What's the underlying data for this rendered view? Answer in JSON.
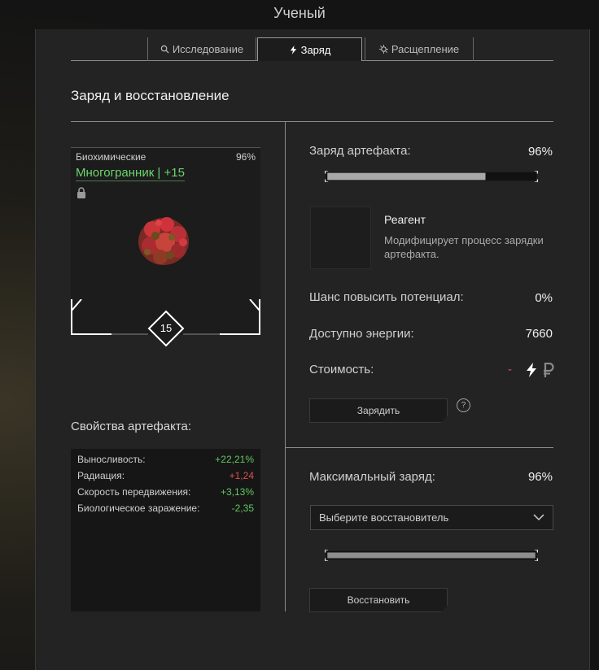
{
  "window": {
    "title": "Ученый"
  },
  "tabs": [
    {
      "label": "Исследование",
      "icon": "search-icon"
    },
    {
      "label": "Заряд",
      "icon": "lightning-icon",
      "active": true
    },
    {
      "label": "Расщепление",
      "icon": "split-icon"
    }
  ],
  "section_title": "Заряд и восстановление",
  "artifact": {
    "category": "Биохимические",
    "percent": "96%",
    "name": "Многогранник | +15",
    "level": "15",
    "locked": true
  },
  "properties": {
    "title": "Свойства артефакта:",
    "rows": [
      {
        "label": "Выносливость:",
        "value": "+22,21%",
        "color": "#5fc95f"
      },
      {
        "label": "Радиация:",
        "value": "+1,24",
        "color": "#e05050"
      },
      {
        "label": "Скорость передвижения:",
        "value": "+3,13%",
        "color": "#5fc95f"
      },
      {
        "label": "Биологическое заражение:",
        "value": "-2,35",
        "color": "#5fc95f"
      }
    ]
  },
  "charge": {
    "label": "Заряд артефакта:",
    "value": "96%",
    "fill": 0.76
  },
  "reagent": {
    "title": "Реагент",
    "description": "Модифицирует процесс зарядки артефакта."
  },
  "stats": {
    "chance_label": "Шанс повысить потенциал:",
    "chance_value": "0%",
    "energy_label": "Доступно энергии:",
    "energy_value": "7660",
    "cost_label": "Стоимость:",
    "cost_value": "-",
    "cost_icons": [
      "lightning-icon",
      "ruble-icon"
    ]
  },
  "charge_button": "Зарядить",
  "help": "?",
  "max_charge": {
    "label": "Максимальный заряд:",
    "value": "96%",
    "select_placeholder": "Выберите восстановитель",
    "fill": 1.0
  },
  "restore_button": "Восстановить",
  "colors": {
    "accent_green": "#6bd56b",
    "negative": "#e05050",
    "bar_fill": "#a8a8a8"
  }
}
